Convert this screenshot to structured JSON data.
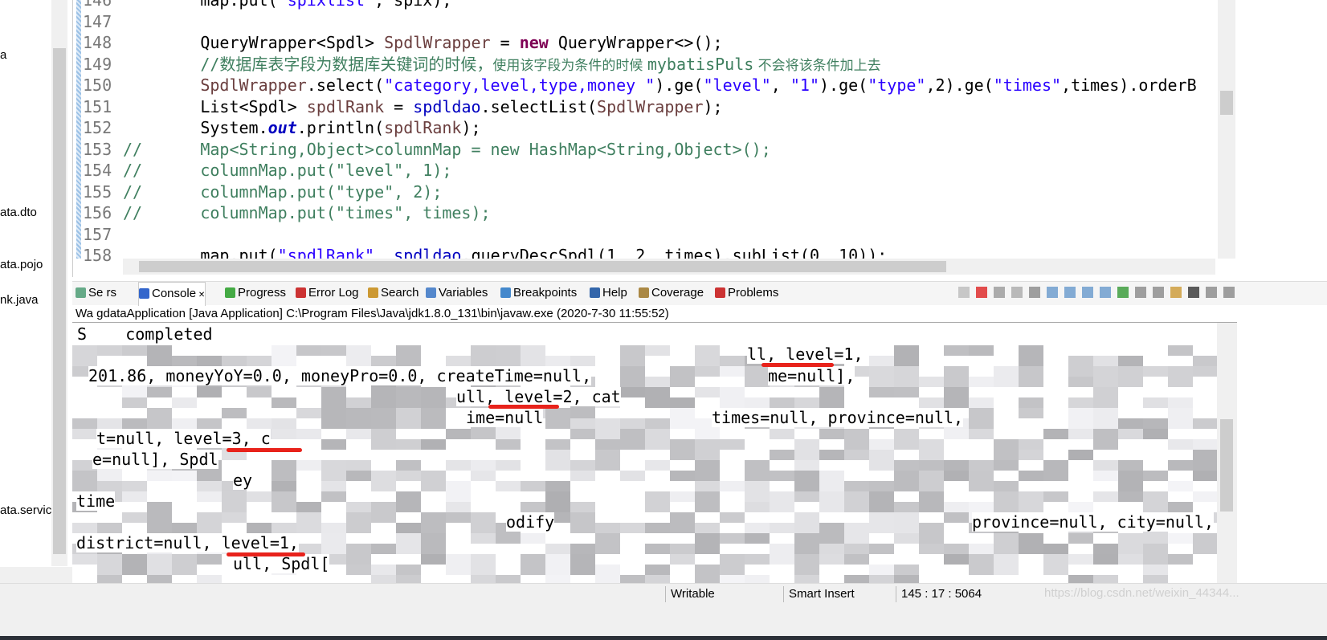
{
  "package_explorer": {
    "items": [
      "a",
      "ata.dto",
      "ata.pojo",
      "nk.java",
      "ata.servic"
    ]
  },
  "editor": {
    "lines": [
      {
        "n": "146",
        "parts": [
          [
            "",
            "        map.put("
          ],
          [
            "str",
            "\"spixlist\""
          ],
          [
            "",
            ", spix);"
          ]
        ]
      },
      {
        "n": "147",
        "parts": []
      },
      {
        "n": "148",
        "parts": [
          [
            "",
            "        QueryWrapper<Spdl> "
          ],
          [
            "var",
            "SpdlWrapper"
          ],
          [
            "",
            " = "
          ],
          [
            "kw",
            "new"
          ],
          [
            "",
            " QueryWrapper<>();"
          ]
        ]
      },
      {
        "n": "149",
        "parts": [
          [
            "cm",
            "        //数据库表字段为数据库关键词的时候，"
          ],
          [
            "cmz",
            "使用该字段为条件的时候 "
          ],
          [
            "cm",
            "mybatisPuls"
          ],
          [
            "cmz",
            " 不会将该条件加上去"
          ]
        ]
      },
      {
        "n": "150",
        "parts": [
          [
            "var",
            "        SpdlWrapper"
          ],
          [
            "",
            ".select("
          ],
          [
            "str",
            "\"category,level,type,money \""
          ],
          [
            "",
            ").ge("
          ],
          [
            "str",
            "\"level\""
          ],
          [
            "",
            ", "
          ],
          [
            "str",
            "\"1\""
          ],
          [
            "",
            ").ge("
          ],
          [
            "str",
            "\"type\""
          ],
          [
            "",
            ",2).ge("
          ],
          [
            "str",
            "\"times\""
          ],
          [
            "",
            ",times).orderB"
          ]
        ]
      },
      {
        "n": "151",
        "parts": [
          [
            "",
            "        List<Spdl> "
          ],
          [
            "var",
            "spdlRank"
          ],
          [
            "",
            " = "
          ],
          [
            "fld",
            "spdldao"
          ],
          [
            "",
            ".selectList("
          ],
          [
            "var",
            "SpdlWrapper"
          ],
          [
            "",
            ");"
          ]
        ]
      },
      {
        "n": "152",
        "parts": [
          [
            "",
            "        System."
          ],
          [
            "st",
            "out"
          ],
          [
            "",
            ".println("
          ],
          [
            "var",
            "spdlRank"
          ],
          [
            "",
            ");"
          ]
        ]
      },
      {
        "n": "153",
        "parts": [
          [
            "cm",
            "//      Map<String,Object>columnMap = new HashMap<String,Object>();"
          ]
        ]
      },
      {
        "n": "154",
        "parts": [
          [
            "cm",
            "//      columnMap.put(\"level\", 1);"
          ]
        ]
      },
      {
        "n": "155",
        "parts": [
          [
            "cm",
            "//      columnMap.put(\"type\", 2);"
          ]
        ]
      },
      {
        "n": "156",
        "parts": [
          [
            "cm",
            "//      columnMap.put(\"times\", times);"
          ]
        ]
      },
      {
        "n": "157",
        "parts": []
      },
      {
        "n": "158",
        "parts": [
          [
            "",
            "        map.put("
          ],
          [
            "str",
            "\"spdlRank\""
          ],
          [
            ",",
            ", "
          ],
          [
            "fld",
            "spdldao"
          ],
          [
            "",
            ".queryDescSpdl(1, 2, times).subList(0, 10));"
          ]
        ]
      }
    ]
  },
  "views": {
    "tabs": [
      "Se  rs",
      "Console",
      "Progress",
      "Error Log",
      "Search",
      "Variables",
      "Breakpoints",
      "Help",
      "Coverage",
      "Problems"
    ],
    "active": "Console"
  },
  "console": {
    "header": "Wa      gdataApplication [Java Application] C:\\Program Files\\Java\\jdk1.8.0_131\\bin\\javaw.exe  (2020-7-30 11:55:52)",
    "fragments": [
      "S    completed",
      "ll, level=1,",
      "201.86, moneyYoY=0.0, moneyPro=0.0, createTime=null,",
      "me=null],",
      "ull, level=2, cat",
      "ime=null",
      "times=null, province=null,",
      "t=null, level=3, c",
      "e=null], Spdl",
      "ey",
      "time",
      "odify",
      "province=null, city=null,",
      "district=null, level=1,",
      "ull, Spdl["
    ]
  },
  "status": {
    "writable": "Writable",
    "insert_mode": "Smart Insert",
    "position": "145 : 17 : 5064",
    "watermark": "https://blog.csdn.net/weixin_44344..."
  },
  "colors": {
    "keyword": "#7f0055",
    "string": "#2a00ff",
    "comment": "#3f7f5f",
    "underline": "#e8221b"
  }
}
